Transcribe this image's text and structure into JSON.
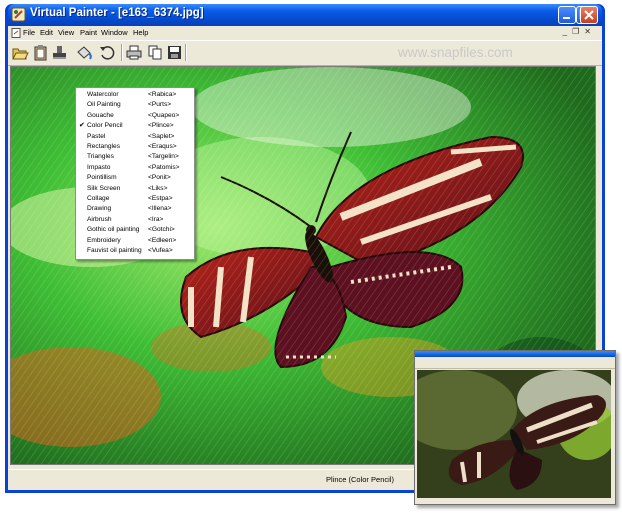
{
  "window": {
    "title": "Virtual Painter - [e163_6374.jpg]",
    "controls": [
      "minimize",
      "maximize",
      "close"
    ]
  },
  "menubar": {
    "items": [
      "File",
      "Edit",
      "View",
      "Paint",
      "Window",
      "Help"
    ]
  },
  "toolbar": {
    "tools": [
      "open-icon",
      "clipboard-icon",
      "stamp-icon",
      "paint-bucket-icon",
      "undo-icon",
      "print-icon",
      "copy-icon",
      "save-icon"
    ]
  },
  "watermark": "www.snapfiles.com",
  "style_menu": {
    "selected": "Color Pencil",
    "items": [
      {
        "name": "Watercolor",
        "code": "<Rabica>"
      },
      {
        "name": "Oil Painting",
        "code": "<Purts>"
      },
      {
        "name": "Gouache",
        "code": "<Quapeo>"
      },
      {
        "name": "Color Pencil",
        "code": "<Plince>",
        "checked": true
      },
      {
        "name": "Pastel",
        "code": "<Saplet>"
      },
      {
        "name": "Rectangles",
        "code": "<Eraqus>"
      },
      {
        "name": "Triangles",
        "code": "<Targelin>"
      },
      {
        "name": "Impasto",
        "code": "<Patomis>"
      },
      {
        "name": "Pointillism",
        "code": "<Ponit>"
      },
      {
        "name": "Silk Screen",
        "code": "<Liks>"
      },
      {
        "name": "Collage",
        "code": "<Estpa>"
      },
      {
        "name": "Drawing",
        "code": "<Illena>"
      },
      {
        "name": "Airbrush",
        "code": "<Ira>"
      },
      {
        "name": "Gothic oil painting",
        "code": "<Gotchi>"
      },
      {
        "name": "Embroidery",
        "code": "<Edleen>"
      },
      {
        "name": "Fauvist oil painting",
        "code": "<Vufea>"
      }
    ]
  },
  "statusbar": {
    "text": "Plince  (Color Pencil)"
  },
  "colors": {
    "titlebar": "#0a5de8",
    "chrome": "#ece9d8",
    "canvas_green": "#3d9a2e",
    "butterfly_red": "#8e1b1a"
  }
}
